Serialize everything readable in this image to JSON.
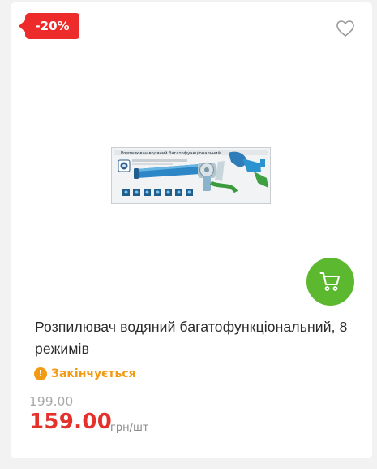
{
  "product": {
    "discount_badge": "-20%",
    "title": "Розпилювач водяний багатофункціональний, 8 режимів",
    "status": "Закінчується",
    "status_icon_glyph": "!",
    "old_price": "199.00",
    "price": "159.00",
    "unit": "грн/шт",
    "box_label": "Розпилювач водяний багатофункціональний"
  },
  "icons": {
    "wishlist": "heart-outline-icon",
    "cart": "shopping-cart-icon",
    "status": "warning-circle-icon"
  },
  "colors": {
    "discount": "#ee2b2b",
    "cart_button": "#5cb82e",
    "status": "#f39a14",
    "price": "#e5312b",
    "old_price": "#a9a9a9"
  }
}
